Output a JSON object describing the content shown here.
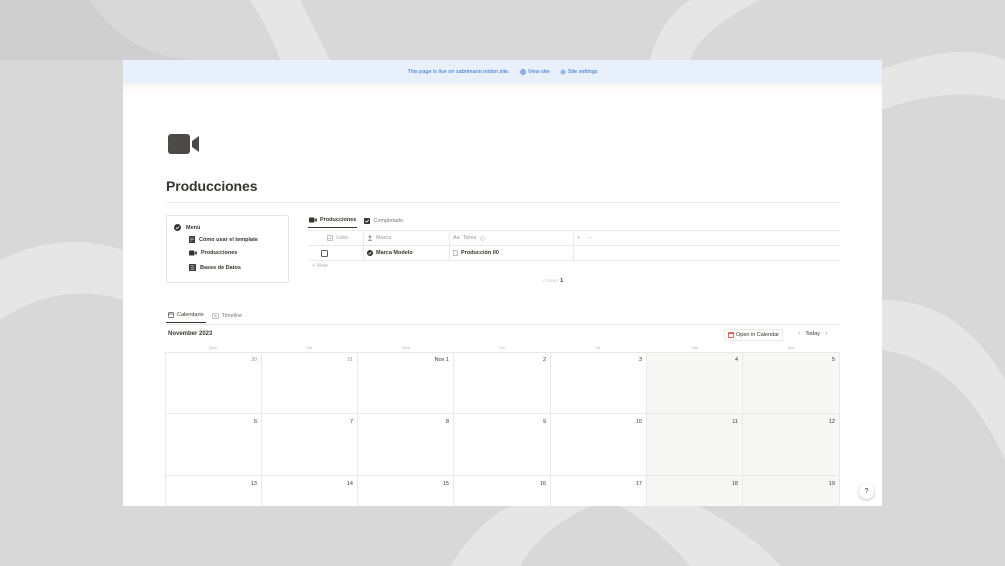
{
  "banner": {
    "text": "This page is live on sabrimarin.notion.site.",
    "view_site": "View site",
    "site_settings": "Site settings"
  },
  "page": {
    "icon": "video-camera-icon",
    "title": "Producciones"
  },
  "menu": {
    "heading": "Menú",
    "items": [
      {
        "label": "Cómo usar el template",
        "icon": "document-icon"
      },
      {
        "label": "Producciones",
        "icon": "video-camera-icon"
      },
      {
        "label": "Bases de Datos",
        "icon": "list-icon"
      }
    ]
  },
  "database": {
    "tabs": [
      {
        "label": "Producciones",
        "icon": "video-camera-icon",
        "active": true
      },
      {
        "label": "Completado",
        "icon": "checkbox-icon",
        "active": false
      }
    ],
    "columns": [
      {
        "label": "Listo",
        "icon": "checkbox-property-icon"
      },
      {
        "label": "Marca",
        "icon": "person-icon"
      },
      {
        "label": "Tarea",
        "prefix": "Aa",
        "icon": "info-icon"
      },
      {
        "label": "+",
        "extra": "···"
      }
    ],
    "rows": [
      {
        "listo": false,
        "marca": "Marca Modelo",
        "tarea": "Producción 00"
      }
    ],
    "new_label": "+ New",
    "count_label": "COUNT",
    "count_value": "1"
  },
  "calendar": {
    "tabs": [
      {
        "label": "Calendario",
        "icon": "calendar-icon",
        "active": true
      },
      {
        "label": "Timeline",
        "icon": "timeline-icon",
        "active": false
      }
    ],
    "month": "November 2023",
    "open_in_calendar": "Open in Calendar",
    "today": "Today",
    "prev": "‹",
    "next": "›",
    "weekdays": [
      "Mon",
      "Tue",
      "Wed",
      "Thu",
      "Fri",
      "Sat",
      "Sun"
    ],
    "weeks": [
      [
        "30",
        "31",
        "Nov 1",
        "2",
        "3",
        "4",
        "5"
      ],
      [
        "6",
        "7",
        "8",
        "9",
        "10",
        "11",
        "12"
      ],
      [
        "13",
        "14",
        "15",
        "16",
        "17",
        "18",
        "19"
      ]
    ]
  },
  "help": "?"
}
